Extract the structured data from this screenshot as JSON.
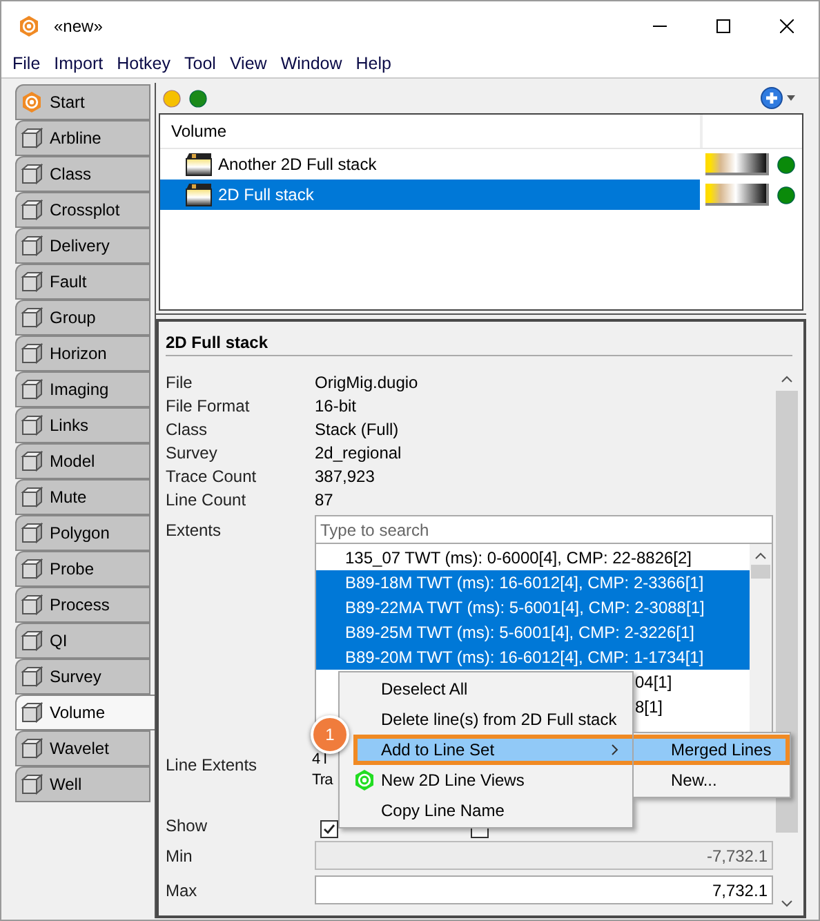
{
  "window": {
    "title": "«new»"
  },
  "menu_bar": [
    "File",
    "Import",
    "Hotkey",
    "Tool",
    "View",
    "Window",
    "Help"
  ],
  "sidebar": {
    "tabs": [
      {
        "label": "Start",
        "selected": false
      },
      {
        "label": "Arbline",
        "selected": false
      },
      {
        "label": "Class",
        "selected": false
      },
      {
        "label": "Crossplot",
        "selected": false
      },
      {
        "label": "Delivery",
        "selected": false
      },
      {
        "label": "Fault",
        "selected": false
      },
      {
        "label": "Group",
        "selected": false
      },
      {
        "label": "Horizon",
        "selected": false
      },
      {
        "label": "Imaging",
        "selected": false
      },
      {
        "label": "Links",
        "selected": false
      },
      {
        "label": "Model",
        "selected": false
      },
      {
        "label": "Mute",
        "selected": false
      },
      {
        "label": "Polygon",
        "selected": false
      },
      {
        "label": "Probe",
        "selected": false
      },
      {
        "label": "Process",
        "selected": false
      },
      {
        "label": "QI",
        "selected": false
      },
      {
        "label": "Survey",
        "selected": false
      },
      {
        "label": "Volume",
        "selected": true
      },
      {
        "label": "Wavelet",
        "selected": false
      },
      {
        "label": "Well",
        "selected": false
      }
    ]
  },
  "volume_list": {
    "header": "Volume",
    "rows": [
      {
        "name": "Another 2D Full stack",
        "selected": false
      },
      {
        "name": "2D Full stack",
        "selected": true
      }
    ]
  },
  "details": {
    "title": "2D Full stack",
    "properties": [
      {
        "label": "File",
        "value": "OrigMig.dugio"
      },
      {
        "label": "File Format",
        "value": "16-bit"
      },
      {
        "label": "Class",
        "value": "Stack (Full)"
      },
      {
        "label": "Survey",
        "value": "2d_regional"
      },
      {
        "label": "Trace Count",
        "value": "387,923"
      },
      {
        "label": "Line Count",
        "value": "87"
      }
    ],
    "extents": {
      "label": "Extents",
      "placeholder": "Type to search",
      "lines": [
        {
          "text": "135_07 TWT (ms): 0-6000[4], CMP: 22-8826[2]",
          "selected": false,
          "kind": "full"
        },
        {
          "text": "B89-18M TWT (ms): 16-6012[4], CMP: 2-3366[1]",
          "selected": true,
          "kind": "full"
        },
        {
          "text": "B89-22MA TWT (ms): 5-6001[4], CMP: 2-3088[1]",
          "selected": true,
          "kind": "full"
        },
        {
          "text": "B89-25M TWT (ms): 5-6001[4], CMP: 2-3226[1]",
          "selected": true,
          "kind": "full"
        },
        {
          "text": "B89-20M TWT (ms): 16-6012[4], CMP: 1-1734[1]",
          "selected": true,
          "kind": "full"
        },
        {
          "text": "04[1]",
          "selected": false,
          "kind": "clipped"
        },
        {
          "text": "8[1]",
          "selected": false,
          "kind": "clipped"
        }
      ]
    },
    "line_extents": {
      "label": "Line Extents",
      "value_lines": [
        "4 l",
        "Tra"
      ]
    },
    "show": {
      "label": "Show",
      "checkboxes": [
        {
          "checked": true
        },
        {
          "checked": false
        }
      ]
    },
    "min": {
      "label": "Min",
      "value": "-7,732.1",
      "disabled": true
    },
    "max": {
      "label": "Max",
      "value": "7,732.1",
      "disabled": false
    }
  },
  "context_menu": {
    "items": [
      {
        "label": "Deselect All",
        "highlighted": false,
        "has_submenu": false,
        "has_icon": false
      },
      {
        "label": "Delete line(s) from 2D Full stack",
        "highlighted": false,
        "has_submenu": false,
        "has_icon": false
      },
      {
        "label": "Add to Line Set",
        "highlighted": true,
        "has_submenu": true,
        "has_icon": false
      },
      {
        "label": "New 2D Line Views",
        "highlighted": false,
        "has_submenu": false,
        "has_icon": true
      },
      {
        "label": "Copy Line Name",
        "highlighted": false,
        "has_submenu": false,
        "has_icon": false
      }
    ]
  },
  "submenu": {
    "items": [
      {
        "label": "Merged Lines",
        "highlighted": true
      },
      {
        "label": "New...",
        "highlighted": false
      }
    ]
  },
  "callout": {
    "label": "1"
  }
}
